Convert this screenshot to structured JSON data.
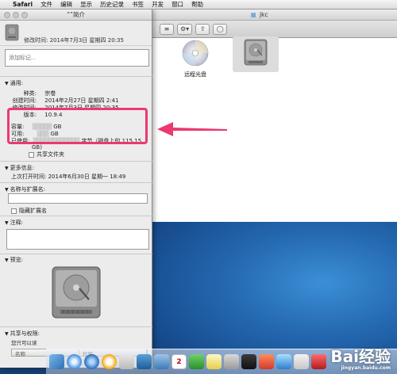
{
  "menubar": {
    "apple": "",
    "app": "Safari",
    "items": [
      "文件",
      "编辑",
      "显示",
      "历史记录",
      "书签",
      "开发",
      "窗口",
      "帮助"
    ]
  },
  "finder": {
    "title": "jkc",
    "toolbar": {
      "view_btn": "≡",
      "gear_btn": "⚙▾",
      "share_btn": "⇪",
      "tag_btn": "◯"
    },
    "items": [
      {
        "label": "远程光盘",
        "icon": "cd-disc-icon"
      },
      {
        "label": "",
        "icon": "hard-drive-icon"
      }
    ]
  },
  "info": {
    "title": "“”简介",
    "name": "",
    "modified": "修改时间: 2014年7月3日 星期四 20:35",
    "tags_placeholder": "添加标记...",
    "general": {
      "heading": "通用:",
      "rows": [
        {
          "k": "种类:",
          "v": "宗卷"
        },
        {
          "k": "创建时间:",
          "v": "2014年2月27日 星期四 2:41"
        },
        {
          "k": "修改时间:",
          "v": "2014年7月3日 星期四 20:35"
        },
        {
          "k": "版本:",
          "v": "10.9.4"
        }
      ],
      "capacity": {
        "k": "容量:",
        "v": "GB"
      },
      "available": {
        "k": "可用:",
        "v": "GB"
      },
      "used": {
        "k": "已使用:",
        "v": "字节（磁盘上的 115.15",
        "v2": "GB)"
      },
      "shared_folder": "共享文件夹"
    },
    "more": {
      "heading": "更多信息:",
      "last_opened": "上次打开时间: 2014年6月30日 星期一 18:49"
    },
    "name_ext": {
      "heading": "名称与扩展名:",
      "value": "",
      "hide_ext": "隐藏扩展名"
    },
    "comments": {
      "heading": "注释:"
    },
    "preview": {
      "heading": "预览:"
    },
    "sharing": {
      "heading": "共享与权限:",
      "subtitle": "您只可以读",
      "col_name": "名称",
      "col_priv": "权限"
    }
  },
  "dock": {
    "calendar_day": "2"
  },
  "watermark": {
    "brand": "Bai经验",
    "url": "jingyan.baidu.com"
  },
  "colors": {
    "highlight": "#ea3a6f",
    "arrow": "#ea3a6f"
  }
}
